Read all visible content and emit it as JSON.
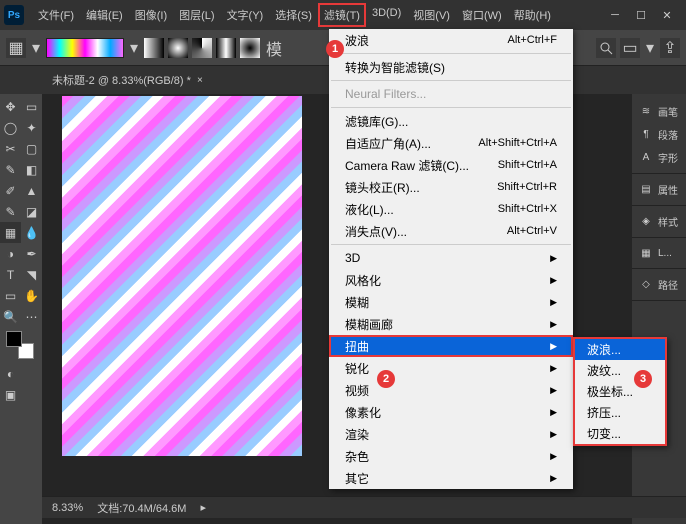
{
  "titlebar": {
    "logo": "Ps",
    "menus": [
      "文件(F)",
      "编辑(E)",
      "图像(I)",
      "图层(L)",
      "文字(Y)",
      "选择(S)",
      "滤镜(T)",
      "3D(D)",
      "视图(V)",
      "窗口(W)",
      "帮助(H)"
    ]
  },
  "document_tab": {
    "title": "未标题-2 @ 8.33%(RGB/8) *",
    "close": "×"
  },
  "dropdown": {
    "items": [
      {
        "label": "波浪",
        "shortcut": "Alt+Ctrl+F",
        "type": "item"
      },
      {
        "type": "sep"
      },
      {
        "label": "转换为智能滤镜(S)",
        "type": "item"
      },
      {
        "type": "sep"
      },
      {
        "label": "Neural Filters...",
        "type": "item",
        "disabled": true
      },
      {
        "type": "sep"
      },
      {
        "label": "滤镜库(G)...",
        "type": "item"
      },
      {
        "label": "自适应广角(A)...",
        "shortcut": "Alt+Shift+Ctrl+A",
        "type": "item"
      },
      {
        "label": "Camera Raw 滤镜(C)...",
        "shortcut": "Shift+Ctrl+A",
        "type": "item"
      },
      {
        "label": "镜头校正(R)...",
        "shortcut": "Shift+Ctrl+R",
        "type": "item"
      },
      {
        "label": "液化(L)...",
        "shortcut": "Shift+Ctrl+X",
        "type": "item"
      },
      {
        "label": "消失点(V)...",
        "shortcut": "Alt+Ctrl+V",
        "type": "item"
      },
      {
        "type": "sep"
      },
      {
        "label": "3D",
        "type": "sub"
      },
      {
        "label": "风格化",
        "type": "sub"
      },
      {
        "label": "模糊",
        "type": "sub"
      },
      {
        "label": "模糊画廊",
        "type": "sub"
      },
      {
        "label": "扭曲",
        "type": "sub",
        "hover": true,
        "highlight": true
      },
      {
        "label": "锐化",
        "type": "sub"
      },
      {
        "label": "视频",
        "type": "sub"
      },
      {
        "label": "像素化",
        "type": "sub"
      },
      {
        "label": "渲染",
        "type": "sub"
      },
      {
        "label": "杂色",
        "type": "sub"
      },
      {
        "label": "其它",
        "type": "sub"
      }
    ]
  },
  "submenu": {
    "items": [
      {
        "label": "波浪...",
        "hover": true
      },
      {
        "label": "波纹..."
      },
      {
        "label": "极坐标..."
      },
      {
        "label": "挤压..."
      },
      {
        "label": "切变..."
      }
    ]
  },
  "panels": {
    "groups": [
      [
        {
          "icon": "brush",
          "label": "画笔"
        },
        {
          "icon": "para",
          "label": "段落"
        },
        {
          "icon": "char",
          "label": "字形"
        }
      ],
      [
        {
          "icon": "prop",
          "label": "属性"
        }
      ],
      [
        {
          "icon": "style",
          "label": "样式"
        }
      ],
      [
        {
          "icon": "lib",
          "label": "L..."
        }
      ],
      [
        {
          "icon": "path",
          "label": "路径"
        }
      ]
    ]
  },
  "status": {
    "zoom": "8.33%",
    "doc_label": "文档:",
    "doc_value": "70.4M/64.6M"
  },
  "annotations": {
    "a1": "1",
    "a2": "2",
    "a3": "3"
  }
}
